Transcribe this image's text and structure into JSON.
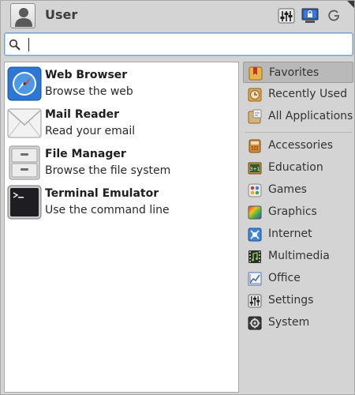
{
  "header": {
    "user_name": "User",
    "avatar_icon": "user-avatar-icon",
    "buttons": [
      {
        "name": "settings-manager-button",
        "icon": "sliders-icon"
      },
      {
        "name": "lock-screen-button",
        "icon": "monitor-lock-icon"
      },
      {
        "name": "logout-button",
        "icon": "power-icon"
      }
    ]
  },
  "search": {
    "value": "",
    "placeholder": "",
    "icon": "search-icon"
  },
  "apps": [
    {
      "title": "Web Browser",
      "description": "Browse the web",
      "icon": "web-browser-icon"
    },
    {
      "title": "Mail Reader",
      "description": "Read your email",
      "icon": "mail-reader-icon"
    },
    {
      "title": "File Manager",
      "description": "Browse the file system",
      "icon": "file-manager-icon"
    },
    {
      "title": "Terminal Emulator",
      "description": "Use the command line",
      "icon": "terminal-icon"
    }
  ],
  "categories_top": [
    {
      "label": "Favorites",
      "icon": "bookmark-icon",
      "selected": true
    },
    {
      "label": "Recently Used",
      "icon": "clock-icon",
      "selected": false
    },
    {
      "label": "All Applications",
      "icon": "all-applications-icon",
      "selected": false
    }
  ],
  "categories": [
    {
      "label": "Accessories",
      "icon": "accessories-icon"
    },
    {
      "label": "Education",
      "icon": "education-icon"
    },
    {
      "label": "Games",
      "icon": "games-icon"
    },
    {
      "label": "Graphics",
      "icon": "graphics-icon"
    },
    {
      "label": "Internet",
      "icon": "internet-icon"
    },
    {
      "label": "Multimedia",
      "icon": "multimedia-icon"
    },
    {
      "label": "Office",
      "icon": "office-icon"
    },
    {
      "label": "Settings",
      "icon": "settings-icon"
    },
    {
      "label": "System",
      "icon": "system-icon"
    }
  ],
  "colors": {
    "panel_background": "#d4d4d4",
    "list_background": "#ffffff",
    "selection": "#b9b9b9",
    "search_focus": "#6fa0d6"
  }
}
